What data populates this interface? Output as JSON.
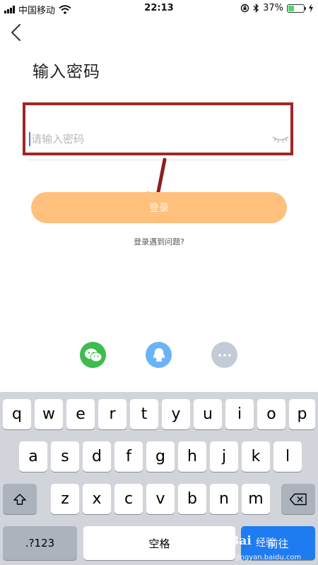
{
  "status_bar": {
    "carrier": "中国移动",
    "time": "22:13",
    "battery_percent": "37%",
    "battery_level": 0.37,
    "icons": [
      "signal-icon",
      "wifi-icon",
      "orientation-lock-icon",
      "bluetooth-icon",
      "battery-icon",
      "charging-icon"
    ]
  },
  "page": {
    "title": "输入密码",
    "password_placeholder": "请输入密码",
    "password_value": "",
    "login_label": "登录",
    "help_link": "登录遇到问题?"
  },
  "social_login": {
    "icons": [
      "wechat-icon",
      "qq-icon",
      "more-icon"
    ],
    "colors": {
      "wechat": "#3ebc4f",
      "qq": "#6ab4f5",
      "more": "#c3ccd6"
    }
  },
  "keyboard": {
    "row1": [
      "q",
      "w",
      "e",
      "r",
      "t",
      "y",
      "u",
      "i",
      "o",
      "p"
    ],
    "row2": [
      "a",
      "s",
      "d",
      "f",
      "g",
      "h",
      "j",
      "k",
      "l"
    ],
    "row3": [
      "z",
      "x",
      "c",
      "v",
      "b",
      "n",
      "m"
    ],
    "numbers_key": ".?123",
    "space_key": "空格",
    "go_key": "前往"
  },
  "watermark": {
    "brand": "Bai",
    "sub": "经验",
    "url": "jingyan.baidu.com"
  },
  "colors": {
    "login_button": "#ffc07e",
    "annotation": "#a32525",
    "caret": "#3f7cd9",
    "go_key": "#1f7cf0"
  }
}
